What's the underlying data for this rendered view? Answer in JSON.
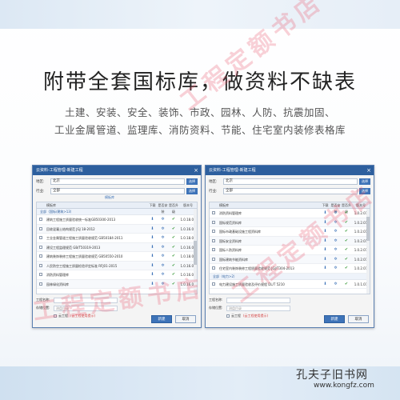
{
  "headline": "附带全套国标库，做资料不缺表",
  "sub_line1": "土建、安装、安全、装饰、市政、园林、人防、抗震加固、",
  "sub_line2": "工业金属管道、监理库、消防资料、节能、住宅室内装修表格库",
  "watermark": "工程定额书店",
  "brand": {
    "logo": "孔夫子旧书网",
    "url": "www.kongfz.com"
  },
  "left_dialog": {
    "title": "云资料-工程管理-新建工程",
    "region_label": "地区:",
    "region_value": "北京",
    "region_button": "选择",
    "industry_label": "行业:",
    "industry_value": "全部",
    "industry_button": "选择",
    "hint": "模板库",
    "columns": [
      "模板库",
      "下载",
      "是否安装",
      "是否升级",
      "版本号"
    ],
    "group": "全部（国标/建筑>13）",
    "rows": [
      {
        "name": "建筑工程施工质量验收统一标准GB50300-2013",
        "version": "1.0.18.01"
      },
      {
        "name": "回收混凝土结构规范 JGJ 18-2012",
        "version": "1.0.16.01"
      },
      {
        "name": "工业金属管道工程施工质量验收规范 GB50184-2011",
        "version": "1.0.18.01"
      },
      {
        "name": "建设工程监理规范 GB/T50319-2013",
        "version": "1.0.16.01"
      },
      {
        "name": "建筑装饰装修工程施工质量验收规范 GB50550-2010",
        "version": "1.0.18.01"
      },
      {
        "name": "人民防空工程施工质量检验评定标准 RFJ01-2015",
        "version": "1.0.16.01"
      },
      {
        "name": "消防资料管理库",
        "version": "1.0.16.01"
      },
      {
        "name": "园林绿化资料库",
        "version": "1.0.16.01"
      }
    ],
    "project_name_label": "工程名称:",
    "project_name_value": "",
    "storage_label": "存储位置:",
    "storage_placeholder": "测盘目录",
    "checkbox_label": "云工程",
    "checkbox_note": "(云工程使用提示)",
    "ok_button": "新建",
    "cancel_button": "取消"
  },
  "right_dialog": {
    "title": "云资料-工程管理-新建工程",
    "region_label": "地区:",
    "region_value": "北京",
    "region_button": "选择",
    "industry_label": "行业:",
    "industry_value": "全部",
    "industry_button": "选择",
    "hint": "",
    "columns": [
      "模板库",
      "下载",
      "是否安装",
      "是否升级",
      "版本号"
    ],
    "group_top": "",
    "rows_top": [
      {
        "name": "消防资料管理库",
        "version": "1.0.2.01"
      },
      {
        "name": "国标规范资料库",
        "version": "1.0.2.01"
      },
      {
        "name": "国标市政基础设施工程资料库",
        "version": "1.0.2.01"
      },
      {
        "name": "国标安全资料库",
        "version": "1.0.2.01"
      },
      {
        "name": "国标人防资料库",
        "version": "1.0.2.01"
      },
      {
        "name": "国标建筑节能资料库",
        "version": "1.0.2.01"
      },
      {
        "name": "住宅室内装饰装修工程质量验收规范 JGJ/T304-2013",
        "version": "1.0.2.01"
      }
    ],
    "group_bottom": "全部（电力>2）",
    "rows_bottom": [
      {
        "name": "电力建设施工质量验收及评价规程 DL/T 5210",
        "version": "1.0.1.01"
      }
    ],
    "project_name_label": "工程名称:",
    "project_name_value": "",
    "storage_label": "存储位置:",
    "storage_placeholder": "测盘目录",
    "checkbox_label": "云工程",
    "checkbox_note": "(云工程使用提示)",
    "ok_button": "新建",
    "cancel_button": "取消"
  }
}
